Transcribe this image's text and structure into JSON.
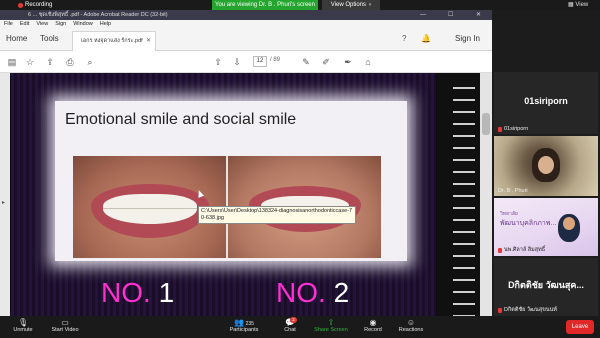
{
  "zoom": {
    "recording_label": "Recording",
    "share_banner": "You are viewing Dr. B . Phuri's screen",
    "view_options": "View Options",
    "view_label": "View",
    "bottom": {
      "unmute": "Unmute",
      "start_video": "Start Video",
      "participants": "Participants",
      "participants_count": "235",
      "chat": "Chat",
      "chat_badge": "2",
      "share_screen": "Share Screen",
      "record": "Record",
      "reactions": "Reactions",
      "leave": "Leave"
    },
    "participants_tiles": [
      {
        "big": "01siriporn",
        "small": "01siriporn"
      },
      {
        "small": "Dr. B . Phuri"
      },
      {
        "line1": "วิทยาลัย",
        "line2": "พัฒนาบุคลิกภาพ...",
        "small": "นพ.ศิลาล์ ลิมสุทธิ์"
      },
      {
        "big": "Dกิตติชัย วัฒนสุค...",
        "small": "Dกิตติชัย วัฒนสุขนนท์"
      }
    ]
  },
  "acrobat": {
    "window_title": "6 ... ชุดเชิงพิสุทธิ์ .pdf - Adobe Acrobat Reader DC (32-bit)",
    "menu": [
      "File",
      "Edit",
      "View",
      "Sign",
      "Window",
      "Help"
    ],
    "tabs": {
      "home": "Home",
      "tools": "Tools",
      "doc": "เอกร หงจุดาแสง ร์กระ.pdf"
    },
    "sign_in": "Sign In",
    "page_current": "12",
    "page_total": "/ 89"
  },
  "slide": {
    "title": "Emotional smile and social smile",
    "tooltip": "C:\\Users\\User\\Desktop\\138324-diagnosisanorthodonticcase-70-638.jpg",
    "label1_word": "NO.",
    "label1_num": "1",
    "label2_word": "NO.",
    "label2_num": "2"
  },
  "colors": {
    "accent_share": "#24a52d",
    "leave": "#e02828",
    "slide_label": "#ff2fd0"
  }
}
